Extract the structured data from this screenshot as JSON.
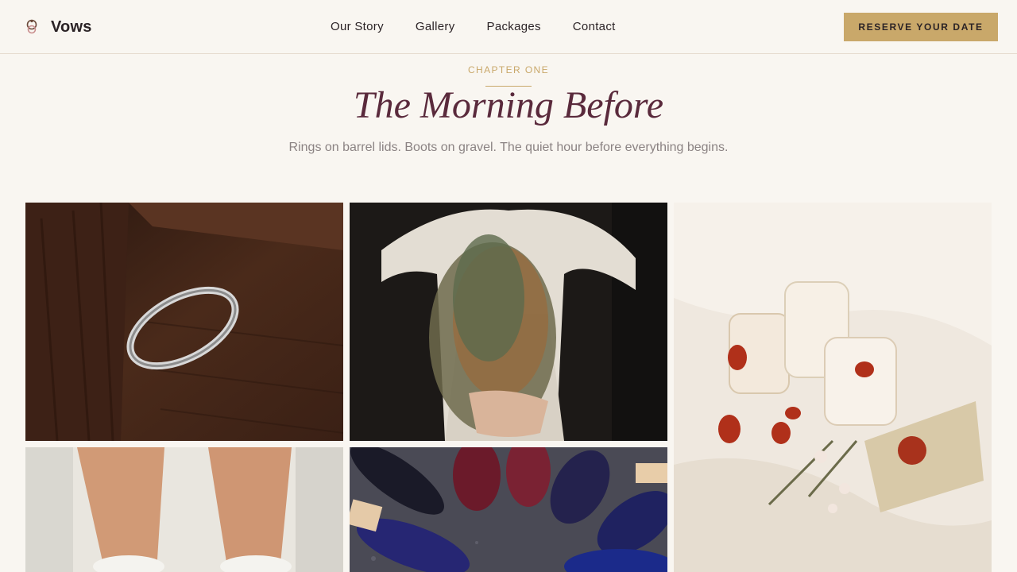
{
  "header": {
    "brand": "Vows",
    "nav": [
      "Our Story",
      "Gallery",
      "Packages",
      "Contact"
    ],
    "cta": "RESERVE YOUR DATE"
  },
  "hero": {
    "eyebrow": "CHAPTER ONE",
    "title": "The Morning Before",
    "subtitle": "Rings on barrel lids. Boots on gravel. The quiet hour before everything begins."
  },
  "gallery": [
    {
      "subject": "ring on wooden barrel lid"
    },
    {
      "subject": "bride holding dried bouquet"
    },
    {
      "subject": "candles with petals and wax-sealed envelope"
    },
    {
      "subject": "legs in white sneakers"
    },
    {
      "subject": "circle of leather dress shoes on gravel"
    }
  ],
  "colors": {
    "background": "#f9f6f1",
    "accent": "#c9a86a",
    "title": "#5a2a3c",
    "text": "#2b2326",
    "muted": "#8b8383"
  }
}
